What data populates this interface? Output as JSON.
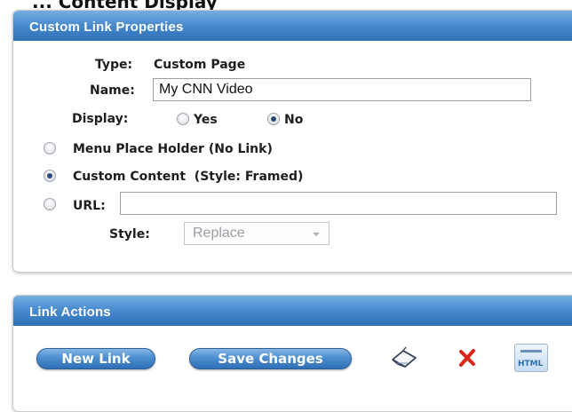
{
  "page_heading_fragment": "... Content Display",
  "properties_panel": {
    "title": "Custom Link Properties",
    "type_label": "Type:",
    "type_value": "Custom Page",
    "name_label": "Name:",
    "name_value": "My CNN Video",
    "display_label": "Display:",
    "display_options": [
      {
        "label": "Yes",
        "selected": false
      },
      {
        "label": "No",
        "selected": true
      }
    ],
    "link_options": [
      {
        "label": "Menu Place Holder (No Link)",
        "selected": false
      },
      {
        "label": "Custom Content  (Style: Framed)",
        "selected": true
      },
      {
        "label": "URL:",
        "selected": false
      }
    ],
    "url_value": "",
    "style_label": "Style:",
    "style_value": "Replace"
  },
  "actions_panel": {
    "title": "Link Actions",
    "new_link_label": "New Link",
    "save_changes_label": "Save Changes",
    "icons": [
      "erase-icon",
      "delete-icon",
      "html-icon"
    ],
    "html_icon_text": "HTML"
  },
  "colors": {
    "header_blue": "#3f80c4",
    "button_blue": "#4d8fd0",
    "delete_red": "#d9261c"
  }
}
